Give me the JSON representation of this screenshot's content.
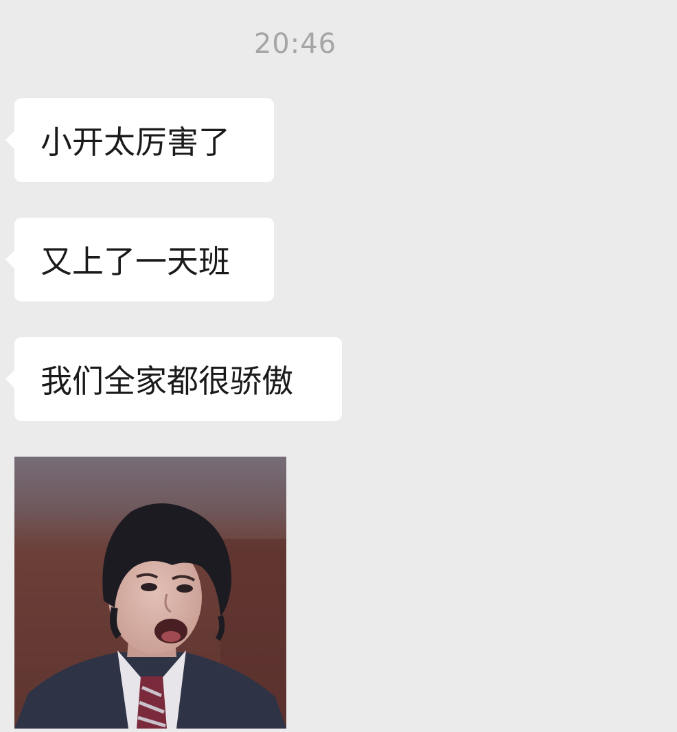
{
  "chat": {
    "timestamp": "20:46",
    "messages": [
      {
        "type": "text",
        "text": "小开太厉害了"
      },
      {
        "type": "text",
        "text": "又上了一天班"
      },
      {
        "type": "text",
        "text": "我们全家都很骄傲"
      },
      {
        "type": "image",
        "icon": "sticker-surprised-boy-icon"
      }
    ]
  },
  "colors": {
    "background": "#ebebeb",
    "bubble": "#ffffff",
    "timestamp": "#a5a5a5",
    "text": "#1a1a1a"
  }
}
